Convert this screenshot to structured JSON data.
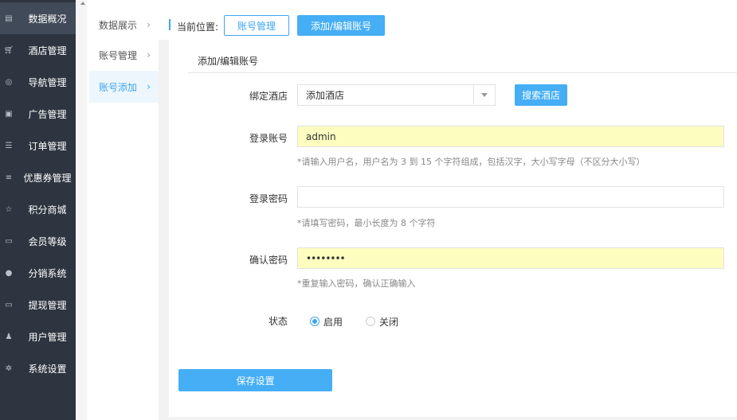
{
  "sidebar": {
    "items": [
      {
        "label": "数据概况",
        "icon": "dashboard-icon"
      },
      {
        "label": "酒店管理",
        "icon": "cart-icon"
      },
      {
        "label": "导航管理",
        "icon": "compass-icon"
      },
      {
        "label": "广告管理",
        "icon": "gift-icon"
      },
      {
        "label": "订单管理",
        "icon": "server-icon"
      },
      {
        "label": "优惠券管理",
        "icon": "list-icon"
      },
      {
        "label": "积分商城",
        "icon": "star-icon"
      },
      {
        "label": "会员等级",
        "icon": "money-icon"
      },
      {
        "label": "分销系统",
        "icon": "users-icon"
      },
      {
        "label": "提现管理",
        "icon": "money-icon"
      },
      {
        "label": "用户管理",
        "icon": "user-icon"
      },
      {
        "label": "系统设置",
        "icon": "gear-icon"
      }
    ],
    "active_index": 0
  },
  "subnav": {
    "items": [
      {
        "label": "数据展示"
      },
      {
        "label": "账号管理"
      },
      {
        "label": "账号添加"
      }
    ],
    "active_index": 2
  },
  "breadcrumb": {
    "label": "当前位置:",
    "items": [
      "账号管理",
      "添加/编辑账号"
    ]
  },
  "panel": {
    "title": "添加/编辑账号"
  },
  "form": {
    "hotel": {
      "label": "绑定酒店",
      "value": "添加酒店",
      "search_label": "搜索酒店"
    },
    "account": {
      "label": "登录账号",
      "value": "admin",
      "hint": "*请输入用户名，用户名为 3 到 15 个字符组成，包括汉字，大小写字母（不区分大小写）"
    },
    "password": {
      "label": "登录密码",
      "value": "",
      "hint": "*请填写密码，最小长度为 8 个字符"
    },
    "confirm": {
      "label": "确认密码",
      "value": "••••••••",
      "hint": "*重复输入密码，确认正确输入"
    },
    "status": {
      "label": "状态",
      "options": [
        "启用",
        "关闭"
      ],
      "selected": "启用"
    },
    "save_label": "保存设置"
  },
  "colors": {
    "accent": "#45aef5",
    "sidebar_bg": "#2e3540",
    "autofill": "#fcfdbf"
  }
}
